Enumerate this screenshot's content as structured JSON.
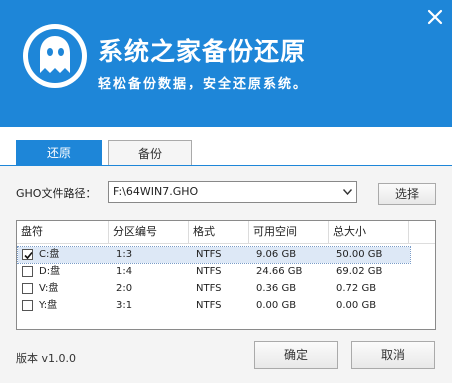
{
  "header": {
    "title": "系统之家备份还原",
    "subtitle": "轻松备份数据，安全还原系统。",
    "logo_icon": "ghost-icon",
    "close_icon": "close-icon",
    "bg_color": "#1e86d8"
  },
  "tabs": [
    {
      "label": "还原",
      "active": true
    },
    {
      "label": "备份",
      "active": false
    }
  ],
  "gho": {
    "label": "GHO文件路径：",
    "value": "F:\\64WIN7.GHO",
    "select_button": "选择"
  },
  "table": {
    "columns": [
      "盘符",
      "分区编号",
      "格式",
      "可用空间",
      "总大小"
    ],
    "rows": [
      {
        "checked": true,
        "drive": "C:盘",
        "partition": "1:3",
        "format": "NTFS",
        "free": "9.06 GB",
        "total": "50.00 GB",
        "selected": true
      },
      {
        "checked": false,
        "drive": "D:盘",
        "partition": "1:4",
        "format": "NTFS",
        "free": "24.66 GB",
        "total": "69.02 GB",
        "selected": false
      },
      {
        "checked": false,
        "drive": "V:盘",
        "partition": "2:0",
        "format": "NTFS",
        "free": "0.36 GB",
        "total": "0.72 GB",
        "selected": false
      },
      {
        "checked": false,
        "drive": "Y:盘",
        "partition": "3:1",
        "format": "NTFS",
        "free": "0.00 GB",
        "total": "0.00 GB",
        "selected": false
      }
    ]
  },
  "footer": {
    "version": "版本 v1.0.0",
    "ok_button": "确定",
    "cancel_button": "取消"
  }
}
